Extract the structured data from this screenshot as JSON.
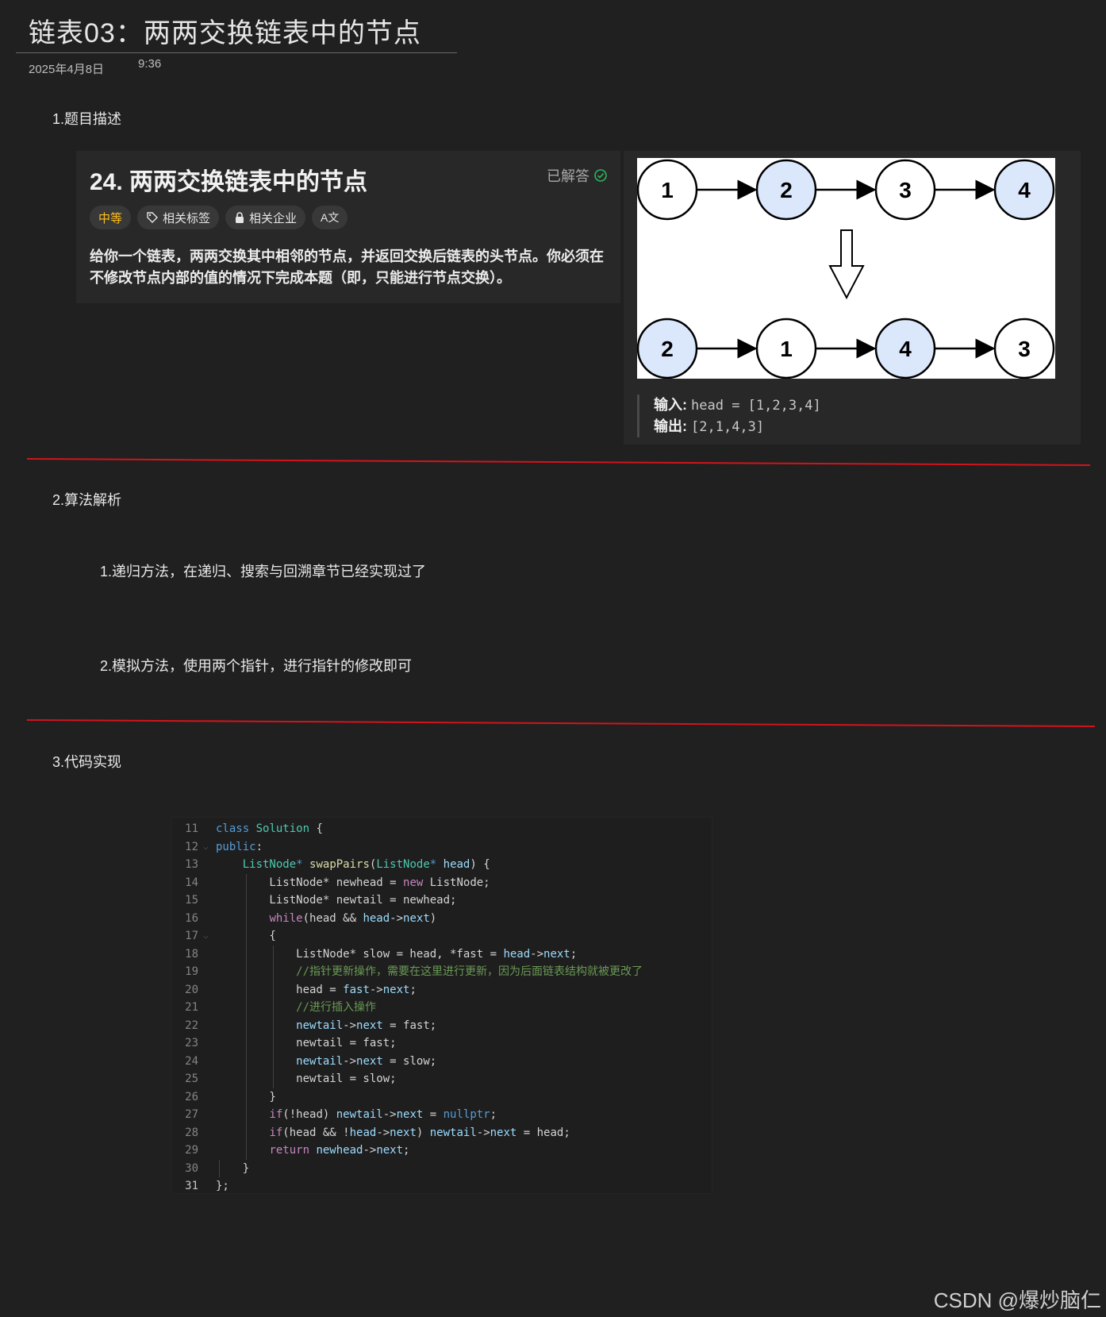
{
  "note": {
    "title": "链表03：两两交换链表中的节点",
    "date": "2025年4月8日",
    "time": "9:36"
  },
  "sections": {
    "s1": "1.题目描述",
    "s2": "2.算法解析",
    "s3": "3.代码实现"
  },
  "problem": {
    "title": "24. 两两交换链表中的节点",
    "status": "已解答",
    "tags": {
      "difficulty": "中等",
      "related_tags": "相关标签",
      "related_companies": "相关企业",
      "translate": "A文"
    },
    "description": "给你一个链表，两两交换其中相邻的节点，并返回交换后链表的头节点。你必须在不修改节点内部的值的情况下完成本题（即，只能进行节点交换）。"
  },
  "example": {
    "before": [
      "1",
      "2",
      "3",
      "4"
    ],
    "after": [
      "2",
      "1",
      "4",
      "3"
    ],
    "input_label": "输入:",
    "input_value": "head = [1,2,3,4]",
    "output_label": "输出:",
    "output_value": "[2,1,4,3]"
  },
  "analysis": {
    "item1": "1.递归方法，在递归、搜索与回溯章节已经实现过了",
    "item2": "2.模拟方法，使用两个指针，进行指针的修改即可"
  },
  "code": {
    "line_numbers": [
      "11",
      "12",
      "13",
      "14",
      "15",
      "16",
      "17",
      "18",
      "19",
      "20",
      "21",
      "22",
      "23",
      "24",
      "25",
      "26",
      "27",
      "28",
      "29",
      "30",
      "31"
    ]
  },
  "watermark": "CSDN @爆炒脑仁",
  "colors": {
    "background": "#202020",
    "card": "#282828",
    "divider": "#d2141c",
    "difficulty": "#ffc01e",
    "solved_check": "#2db55d",
    "node_highlight": "#dbe8fb"
  }
}
